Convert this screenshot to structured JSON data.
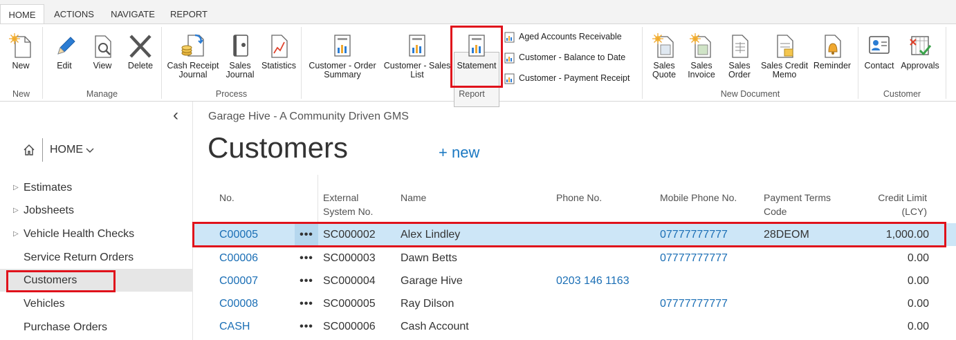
{
  "ribbon": {
    "tabs": [
      "HOME",
      "ACTIONS",
      "NAVIGATE",
      "REPORT"
    ],
    "groups": {
      "new": "New",
      "manage": "Manage",
      "process": "Process",
      "report": "Report",
      "new_document": "New Document",
      "customer": "Customer"
    },
    "buttons": {
      "new": "New",
      "edit": "Edit",
      "view": "View",
      "delete": "Delete",
      "cash_receipt_1": "Cash Receipt",
      "cash_receipt_2": "Journal",
      "sales_journal_1": "Sales",
      "sales_journal_2": "Journal",
      "statistics": "Statistics",
      "order_summary_1": "Customer - Order",
      "order_summary_2": "Summary",
      "sales_list_1": "Customer - Sales",
      "sales_list_2": "List",
      "statement": "Statement",
      "aged_receivable": "Aged Accounts Receivable",
      "balance_to_date": "Customer - Balance to Date",
      "payment_receipt": "Customer - Payment Receipt",
      "sales_quote_1": "Sales",
      "sales_quote_2": "Quote",
      "sales_invoice_1": "Sales",
      "sales_invoice_2": "Invoice",
      "sales_order_1": "Sales",
      "sales_order_2": "Order",
      "credit_memo_1": "Sales Credit",
      "credit_memo_2": "Memo",
      "reminder": "Reminder",
      "contact": "Contact",
      "approvals": "Approvals"
    }
  },
  "nav": {
    "home": "HOME",
    "items": [
      {
        "label": "Estimates"
      },
      {
        "label": "Jobsheets"
      },
      {
        "label": "Vehicle Health Checks"
      },
      {
        "label": "Service Return Orders"
      },
      {
        "label": "Customers"
      },
      {
        "label": "Vehicles"
      },
      {
        "label": "Purchase Orders"
      }
    ]
  },
  "page": {
    "breadcrumb": "Garage Hive - A Community Driven GMS",
    "title": "Customers",
    "new_label": "new"
  },
  "table": {
    "columns": {
      "no": "No.",
      "external_1": "External",
      "external_2": "System No.",
      "name": "Name",
      "phone": "Phone No.",
      "mobile": "Mobile Phone No.",
      "terms_1": "Payment Terms",
      "terms_2": "Code",
      "credit_1": "Credit Limit",
      "credit_2": "(LCY)"
    },
    "rows": [
      {
        "no": "C00005",
        "ext": "SC000002",
        "name": "Alex Lindley",
        "phone": "",
        "mobile": "07777777777",
        "terms": "28DEOM",
        "credit": "1,000.00"
      },
      {
        "no": "C00006",
        "ext": "SC000003",
        "name": "Dawn Betts",
        "phone": "",
        "mobile": "07777777777",
        "terms": "",
        "credit": "0.00"
      },
      {
        "no": "C00007",
        "ext": "SC000004",
        "name": "Garage Hive",
        "phone": "0203 146 1163",
        "mobile": "",
        "terms": "",
        "credit": "0.00"
      },
      {
        "no": "C00008",
        "ext": "SC000005",
        "name": "Ray Dilson",
        "phone": "",
        "mobile": "07777777777",
        "terms": "",
        "credit": "0.00"
      },
      {
        "no": "CASH",
        "ext": "SC000006",
        "name": "Cash Account",
        "phone": "",
        "mobile": "",
        "terms": "",
        "credit": "0.00"
      }
    ],
    "row_menu": "•••"
  },
  "colors": {
    "accent_blue": "#1a78c2",
    "selection": "#cde6f7",
    "highlight_red": "#e0121b"
  }
}
